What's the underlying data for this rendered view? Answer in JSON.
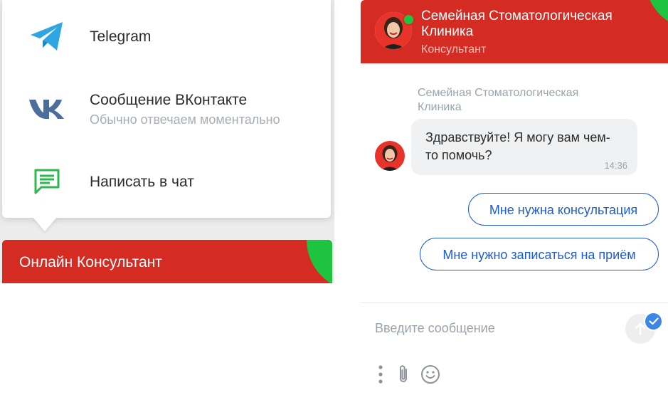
{
  "popup": {
    "channels": [
      {
        "title": "Telegram",
        "subtitle": "",
        "icon": "telegram-icon"
      },
      {
        "title": "Сообщение ВКонтакте",
        "subtitle": "Обычно отвечаем моментально",
        "icon": "vk-icon"
      },
      {
        "title": "Написать в чат",
        "subtitle": "",
        "icon": "chat-icon"
      }
    ]
  },
  "online_bar": {
    "label": "Онлайн Консультант"
  },
  "chat": {
    "header": {
      "title": "Семейная Стоматологическая Клиника",
      "role": "Консультант"
    },
    "message": {
      "sender": "Семейная Стоматологическая Клиника",
      "text": "Здравствуйте! Я могу вам чем-то помочь?",
      "time": "14:36"
    },
    "quick_replies": [
      "Мне нужна консультация",
      "Мне нужно записаться на приём"
    ],
    "input": {
      "placeholder": "Введите сообщение",
      "value": ""
    },
    "tools": [
      "more-icon",
      "paperclip-icon",
      "emoji-icon"
    ]
  },
  "colors": {
    "brand_red": "#d42b22",
    "online_green": "#1ec43f",
    "link_blue": "#1f5bd1",
    "telegram_blue": "#2ea6e3",
    "vk_blue": "#4d6e9a",
    "chat_green": "#2eb84e"
  }
}
